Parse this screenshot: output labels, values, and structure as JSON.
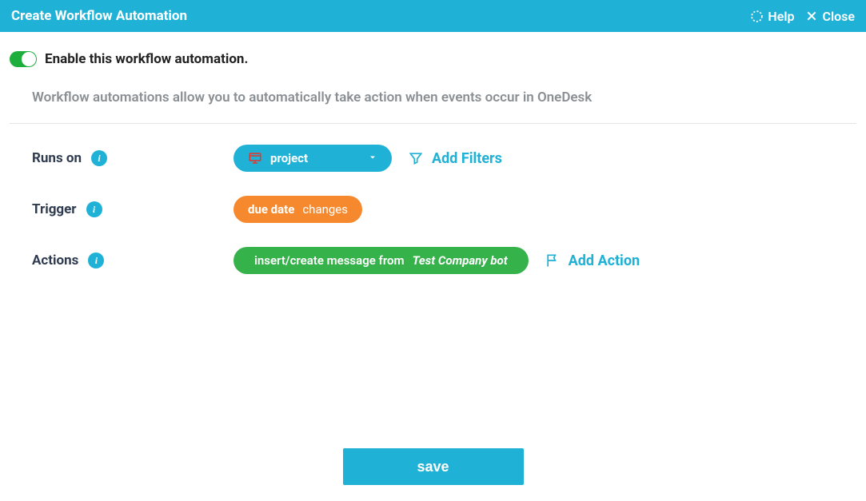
{
  "header": {
    "title": "Create Workflow Automation",
    "help": "Help",
    "close": "Close"
  },
  "enable": {
    "label": "Enable this workflow automation."
  },
  "subtitle": "Workflow automations allow you to automatically take action when events occur in OneDesk",
  "labels": {
    "runs_on": "Runs on",
    "trigger": "Trigger",
    "actions": "Actions"
  },
  "runs_on": {
    "value": "project",
    "add_filters": "Add Filters"
  },
  "trigger": {
    "field": "due date",
    "op": "changes"
  },
  "action": {
    "prefix": "insert/create message from",
    "bot": "Test Company bot",
    "add_action": "Add Action"
  },
  "save": "save"
}
